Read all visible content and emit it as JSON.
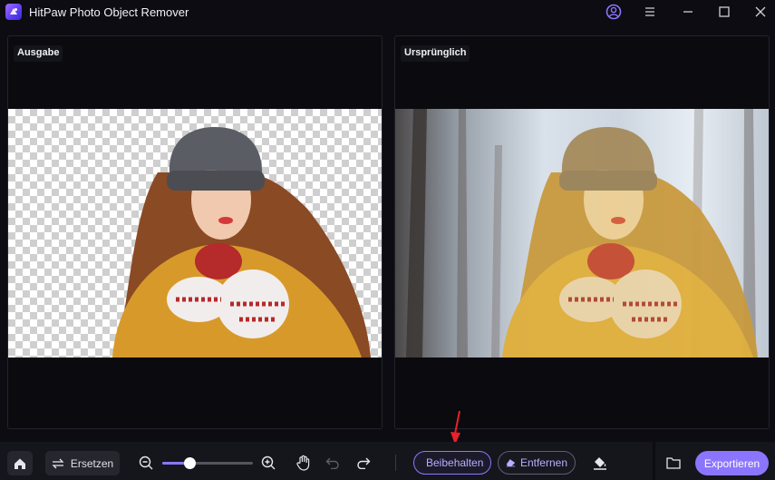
{
  "window": {
    "title": "HitPaw Photo Object Remover",
    "controls": [
      "account-icon",
      "menu-icon",
      "minimize-icon",
      "maximize-icon",
      "close-icon"
    ]
  },
  "panels": {
    "output_label": "Ausgabe",
    "original_label": "Ursprünglich"
  },
  "toolbar": {
    "home_icon": "home-icon",
    "replace_label": "Ersetzen",
    "zoom_level": 0.3,
    "keep_label": "Beibehalten",
    "remove_label": "Entfernen",
    "export_label": "Exportieren"
  },
  "colors": {
    "accent": "#8b75ff",
    "keep_highlight": "#e0b43a",
    "annotation_arrow": "#e8212a"
  }
}
